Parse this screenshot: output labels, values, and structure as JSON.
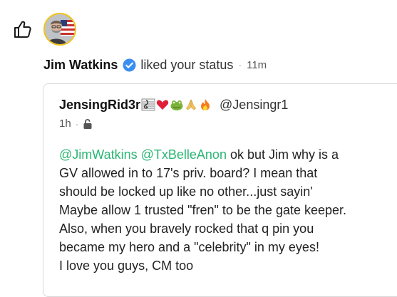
{
  "notification": {
    "actor_name": "Jim Watkins",
    "action_text": "liked your status",
    "separator": "·",
    "time_ago": "11m"
  },
  "status_card": {
    "author_name": "JensingRid3r",
    "author_emojis": [
      "music-score-emoji",
      "heart-emoji",
      "frog-emoji",
      "praying-hands-emoji",
      "fire-emoji"
    ],
    "author_handle": "@Jensingr1",
    "time": "1h",
    "separator": "·",
    "visibility_icon": "unlocked-icon",
    "mention_1": "@JimWatkins",
    "mention_2": "@TxBelleAnon",
    "lines": [
      " ok but Jim why is a",
      "GV allowed in to 17's priv. board? I mean that",
      "should be locked up like no other...just sayin'",
      "Maybe allow 1 trusted \"fren\" to be the gate keeper.",
      "Also, when you bravely rocked that q pin you",
      "became my hero and a \"celebrity\" in my eyes!",
      "I love you guys, CM too"
    ]
  },
  "colors": {
    "mention": "#2bb673",
    "verified": "#3b8ef0",
    "avatar_ring": "#f2c21b"
  }
}
